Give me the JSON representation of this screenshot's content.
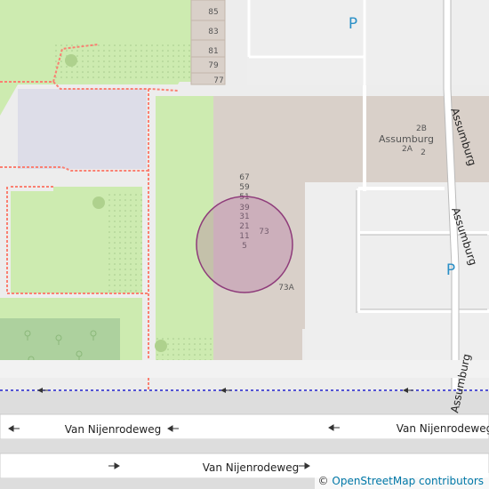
{
  "map": {
    "house_numbers": [
      "85",
      "83",
      "81",
      "79",
      "77",
      "67",
      "59",
      "51",
      "39",
      "31",
      "21",
      "11",
      "5",
      "73",
      "73A",
      "2B",
      "2A",
      "2"
    ],
    "place_label": "Assumburg",
    "streets": {
      "assumburg": "Assumburg",
      "van_nijenrodeweg": "Van Nijenrodeweg"
    },
    "parking_symbol": "P",
    "marker_color": "#8e3b7a"
  },
  "attribution": {
    "copyright_symbol": "©",
    "text": "OpenStreetMap contributors"
  }
}
